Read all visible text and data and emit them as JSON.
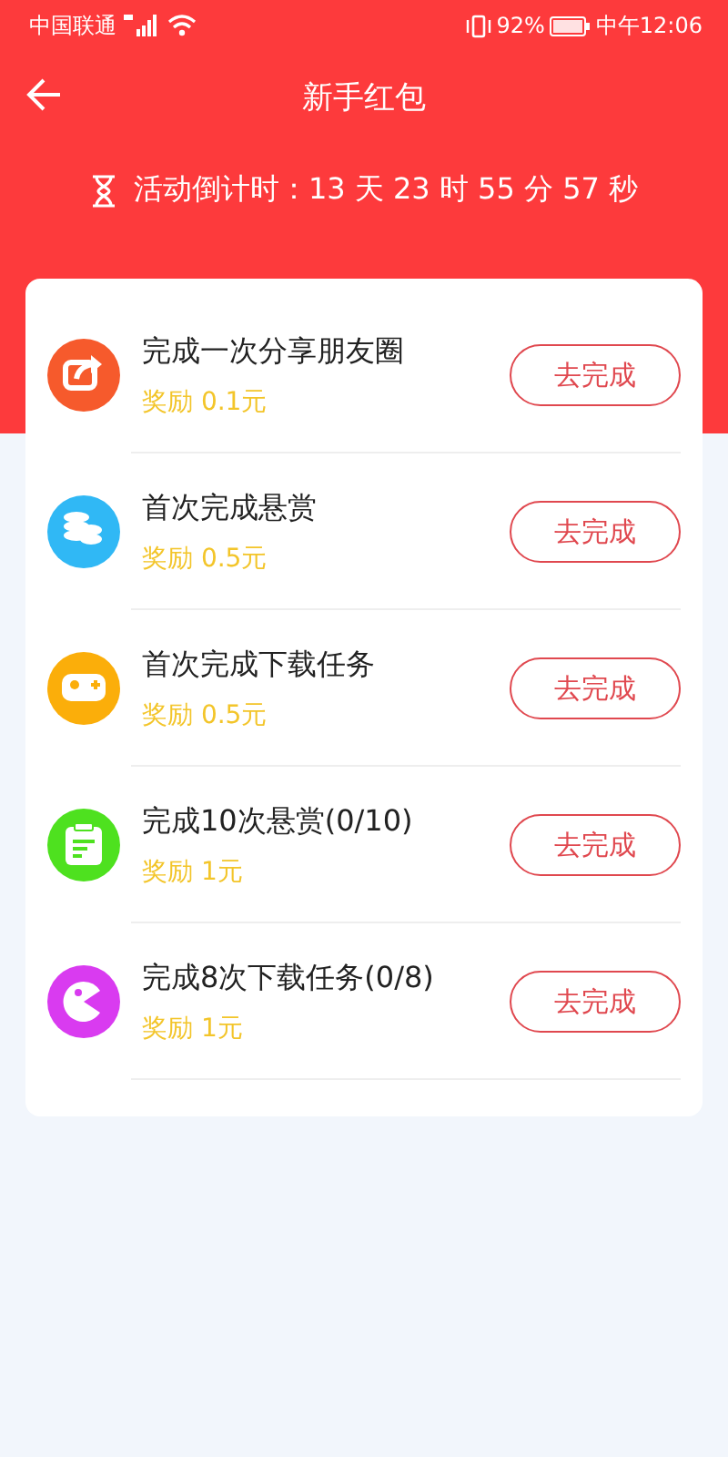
{
  "status_bar": {
    "carrier": "中国联通",
    "battery": "92%",
    "time": "中午12:06"
  },
  "header": {
    "title": "新手红包",
    "countdown": "活动倒计时：13 天 23 时 55 分 57 秒"
  },
  "tasks": [
    {
      "kind": "share",
      "color": "#f65a2c",
      "title": "完成一次分享朋友圈",
      "reward": "奖励 0.1元",
      "button": "去完成"
    },
    {
      "kind": "coins",
      "color": "#30b8f5",
      "title": "首次完成悬赏",
      "reward": "奖励 0.5元",
      "button": "去完成"
    },
    {
      "kind": "gamepad",
      "color": "#fbae0a",
      "title": "首次完成下载任务",
      "reward": "奖励 0.5元",
      "button": "去完成"
    },
    {
      "kind": "clipboard",
      "color": "#4ee11f",
      "title": "完成10次悬赏(0/10)",
      "reward": "奖励 1元",
      "button": "去完成"
    },
    {
      "kind": "pacman",
      "color": "#d93bf0",
      "title": "完成8次下载任务(0/8)",
      "reward": "奖励 1元",
      "button": "去完成"
    }
  ]
}
